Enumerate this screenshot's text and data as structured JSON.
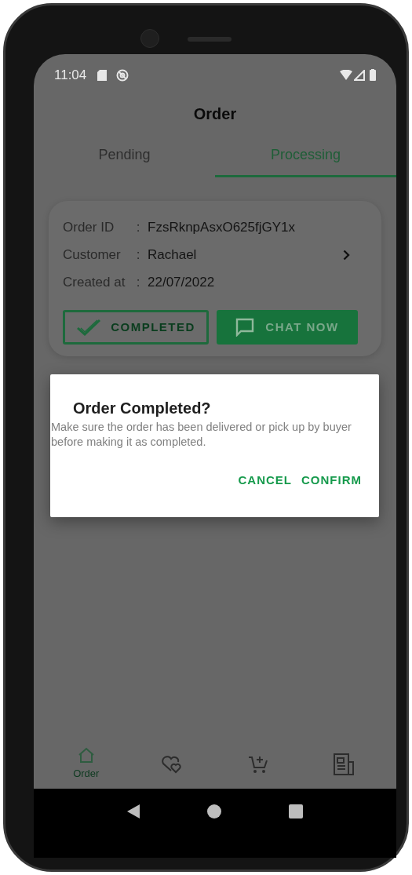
{
  "status_bar": {
    "time": "11:04"
  },
  "title": "Order",
  "tabs": [
    {
      "label": "Pending",
      "selected": false
    },
    {
      "label": "Processing",
      "selected": true
    }
  ],
  "order_card": {
    "fields": [
      {
        "label": "Order ID",
        "separator": ":",
        "value": "FzsRknpAsxO625fjGY1x",
        "kind": "plain"
      },
      {
        "label": "Customer",
        "separator": ":",
        "value": "Rachael",
        "kind": "link"
      },
      {
        "label": "Created at",
        "separator": ":",
        "value": "22/07/2022",
        "kind": "plain"
      }
    ],
    "buttons": [
      {
        "label": "COMPLETED",
        "kind": "outlined"
      },
      {
        "label": "CHAT NOW",
        "kind": "filled"
      }
    ]
  },
  "dialog": {
    "title": "Order Completed?",
    "message": "Make sure the order has been delivered or pick up by buyer before making it as completed.",
    "buttons": [
      "CANCEL",
      "CONFIRM"
    ]
  },
  "bottom_nav": [
    {
      "kind": "home",
      "label": "Order",
      "selected": true
    },
    {
      "kind": "hearts",
      "selected": false
    },
    {
      "kind": "cart",
      "selected": false
    },
    {
      "kind": "news",
      "selected": false
    }
  ]
}
